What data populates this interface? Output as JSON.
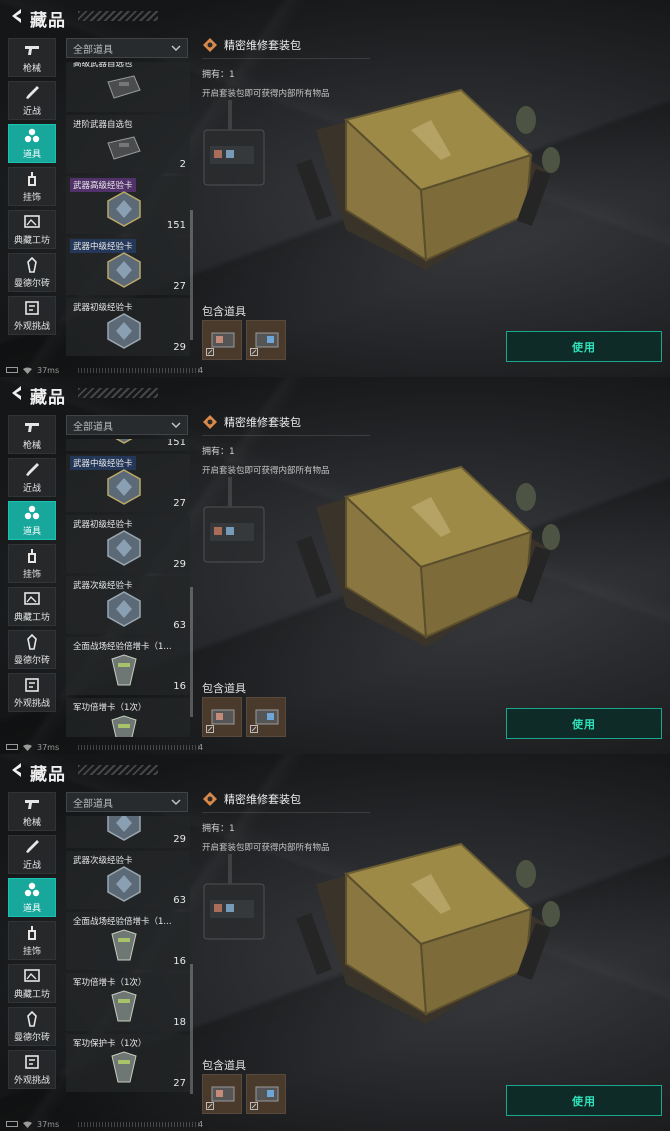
{
  "header": {
    "title": "藏品"
  },
  "nav": {
    "items": [
      {
        "label": "枪械",
        "icon": "pistol-icon",
        "active": false
      },
      {
        "label": "近战",
        "icon": "knife-icon",
        "active": false
      },
      {
        "label": "道具",
        "icon": "items-icon",
        "active": true
      },
      {
        "label": "挂饰",
        "icon": "charm-icon",
        "active": false
      },
      {
        "label": "典藏工坊",
        "icon": "workshop-icon",
        "active": false
      },
      {
        "label": "曼德尔砖",
        "icon": "mandel-brick-icon",
        "active": false
      },
      {
        "label": "外观挑战",
        "icon": "challenge-icon",
        "active": false
      }
    ]
  },
  "filter": {
    "value": "全部道具"
  },
  "items": [
    {
      "label": "高级武器自选包",
      "count": "",
      "style": "plain",
      "thumb": "weapon-case"
    },
    {
      "label": "进阶武器自选包",
      "count": "2",
      "style": "plain",
      "thumb": "weapon-case"
    },
    {
      "label": "武器高级经验卡",
      "count": "151",
      "style": "purple",
      "thumb": "exp-badge"
    },
    {
      "label": "武器中级经验卡",
      "count": "27",
      "style": "blue",
      "thumb": "exp-badge"
    },
    {
      "label": "武器初级经验卡",
      "count": "29",
      "style": "plain",
      "thumb": "exp-badge"
    },
    {
      "label": "武器次级经验卡",
      "count": "63",
      "style": "plain",
      "thumb": "exp-badge"
    },
    {
      "label": "全面战场经验倍增卡（1...",
      "count": "16",
      "style": "plain",
      "thumb": "multiplier"
    },
    {
      "label": "军功倍增卡（1次）",
      "count": "18",
      "style": "plain",
      "thumb": "multiplier"
    },
    {
      "label": "军功保护卡（1次）",
      "count": "27",
      "style": "plain",
      "thumb": "multiplier"
    }
  ],
  "detail": {
    "title": "精密维修套装包",
    "owned": "拥有：1",
    "description": "开启套装包即可获得内部所有物品",
    "contains_label": "包含道具",
    "use_label": "使用"
  },
  "status": {
    "ping": "37ms",
    "page": "4"
  },
  "colors": {
    "accent": "#17a79b",
    "use_text": "#2fe3bd",
    "use_border": "#1ba68f"
  }
}
